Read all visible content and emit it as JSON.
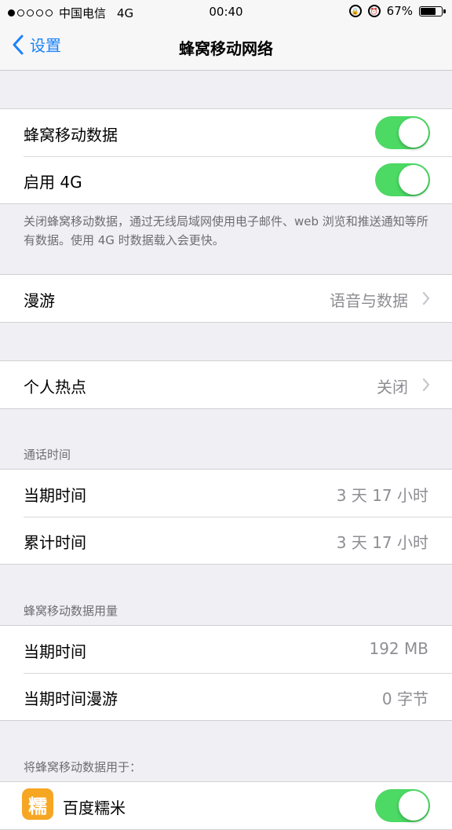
{
  "status_bar": {
    "signal_dots_filled": 1,
    "signal_dots_total": 5,
    "carrier": "中国电信",
    "network": "4G",
    "time": "00:40",
    "battery": "67%",
    "battery_level": 0.67
  },
  "nav": {
    "back_label": "设置",
    "title": "蜂窝移动网络"
  },
  "cellular": {
    "data_label": "蜂窝移动数据",
    "data_on": true,
    "lte_label": "启用 4G",
    "lte_on": true,
    "footnote": "关闭蜂窝移动数据，通过无线局域网使用电子邮件、web 浏览和推送通知等所有数据。使用 4G 时数据载入会更快。"
  },
  "roaming": {
    "label": "漫游",
    "value": "语音与数据"
  },
  "hotspot": {
    "label": "个人热点",
    "value": "关闭"
  },
  "call_time": {
    "header": "通话时间",
    "rows": [
      {
        "label": "当期时间",
        "value": "3 天 17 小时"
      },
      {
        "label": "累计时间",
        "value": "3 天 17 小时"
      }
    ]
  },
  "data_usage": {
    "header": "蜂窝移动数据用量",
    "rows": [
      {
        "label": "当期时间",
        "value": "192 MB"
      },
      {
        "label": "当期时间漫游",
        "value": "0 字节"
      }
    ]
  },
  "apps": {
    "header": "将蜂窝移动数据用于：",
    "items": [
      {
        "label": "百度糯米",
        "icon_text": "糯",
        "icon_color": "#f6a623",
        "on": true
      }
    ]
  },
  "colors": {
    "accent": "#1a82fb",
    "toggle_on": "#4cd964",
    "secondary_text": "#8e8e93"
  }
}
